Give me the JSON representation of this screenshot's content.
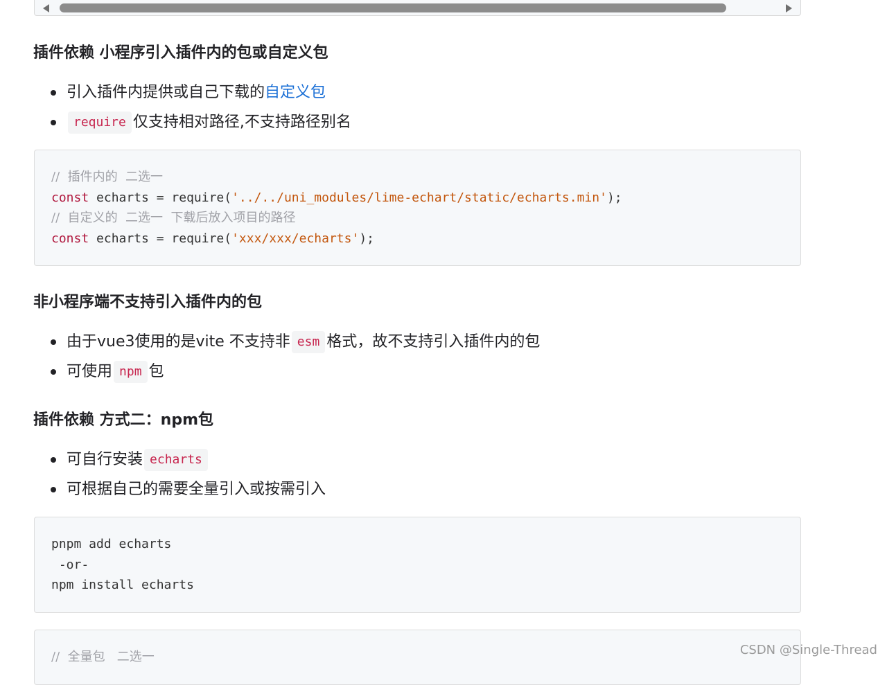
{
  "section1": {
    "title": "插件依赖 小程序引入插件内的包或自定义包",
    "items": [
      {
        "text": "引入插件内提供或自己下载的",
        "link": "自定义包"
      },
      {
        "code": "require",
        "text": "仅支持相对路径,不支持路径别名"
      }
    ],
    "code": {
      "line1_comment": "//  插件内的  二选一",
      "line2_keyword": "const",
      "line2_mid": " echarts = require(",
      "line2_string": "'../../uni_modules/lime-echart/static/echarts.min'",
      "line2_end": ");",
      "line3_comment": "//  自定义的  二选一  下载后放入项目的路径",
      "line4_keyword": "const",
      "line4_mid": " echarts = require(",
      "line4_string": "'xxx/xxx/echarts'",
      "line4_end": ");"
    }
  },
  "section2": {
    "title": "非小程序端不支持引入插件内的包",
    "items": [
      {
        "before": "由于vue3使用的是vite 不支持非",
        "code": "esm",
        "after": "格式，故不支持引入插件内的包"
      },
      {
        "before": "可使用",
        "code": "npm",
        "after": "包"
      }
    ]
  },
  "section3": {
    "title": "插件依赖 方式二：npm包",
    "items": [
      {
        "before": "可自行安装",
        "code": "echarts"
      },
      {
        "text": "可根据自己的需要全量引入或按需引入"
      }
    ],
    "code": {
      "line1": "pnpm add echarts",
      "line2": " -or-",
      "line3": "npm install echarts"
    },
    "code2": {
      "line1_comment": "//  全量包   二选一"
    }
  },
  "watermark": "CSDN @Single-Thread"
}
